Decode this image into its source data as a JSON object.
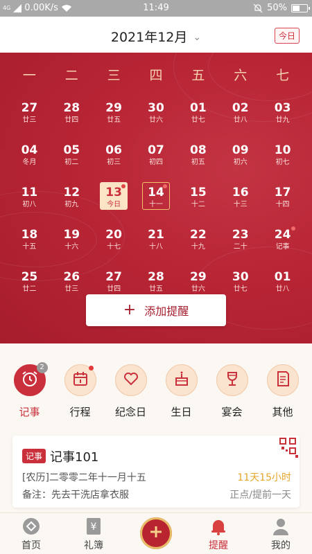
{
  "status_bar": {
    "network": "4G",
    "speed": "0.00K/s",
    "time": "11:49",
    "battery": "50%",
    "battery_level": 0.5
  },
  "header": {
    "month_label": "2021年12月",
    "today_label": "今日"
  },
  "calendar": {
    "weekdays": [
      "一",
      "二",
      "三",
      "四",
      "五",
      "六",
      "七"
    ],
    "days": [
      {
        "num": "27",
        "lunar": "廿三"
      },
      {
        "num": "28",
        "lunar": "廿四"
      },
      {
        "num": "29",
        "lunar": "廿五"
      },
      {
        "num": "30",
        "lunar": "廿六"
      },
      {
        "num": "01",
        "lunar": "廿七"
      },
      {
        "num": "02",
        "lunar": "廿八"
      },
      {
        "num": "03",
        "lunar": "廿九"
      },
      {
        "num": "04",
        "lunar": "冬月"
      },
      {
        "num": "05",
        "lunar": "初二"
      },
      {
        "num": "06",
        "lunar": "初三"
      },
      {
        "num": "07",
        "lunar": "初四"
      },
      {
        "num": "08",
        "lunar": "初五"
      },
      {
        "num": "09",
        "lunar": "初六"
      },
      {
        "num": "10",
        "lunar": "初七"
      },
      {
        "num": "11",
        "lunar": "初八"
      },
      {
        "num": "12",
        "lunar": "初九"
      },
      {
        "num": "13",
        "lunar": "今日",
        "state": "today",
        "dot": true
      },
      {
        "num": "14",
        "lunar": "十一",
        "state": "selected",
        "dot": true
      },
      {
        "num": "15",
        "lunar": "十二"
      },
      {
        "num": "16",
        "lunar": "十三"
      },
      {
        "num": "17",
        "lunar": "十四"
      },
      {
        "num": "18",
        "lunar": "十五"
      },
      {
        "num": "19",
        "lunar": "十六"
      },
      {
        "num": "20",
        "lunar": "十七"
      },
      {
        "num": "21",
        "lunar": "十八"
      },
      {
        "num": "22",
        "lunar": "十九"
      },
      {
        "num": "23",
        "lunar": "二十"
      },
      {
        "num": "24",
        "lunar": "记事",
        "dot": true
      },
      {
        "num": "25",
        "lunar": "廿二"
      },
      {
        "num": "26",
        "lunar": "廿三"
      },
      {
        "num": "27",
        "lunar": "廿四"
      },
      {
        "num": "28",
        "lunar": "廿五"
      },
      {
        "num": "29",
        "lunar": "廿六"
      },
      {
        "num": "30",
        "lunar": "廿七"
      },
      {
        "num": "01",
        "lunar": "廿八"
      }
    ],
    "add_button_label": "添加提醒"
  },
  "categories": [
    {
      "label": "记事",
      "icon": "alarm-clock-icon",
      "active": true,
      "badge": "2"
    },
    {
      "label": "行程",
      "icon": "calendar-icon",
      "reddot": true
    },
    {
      "label": "纪念日",
      "icon": "heart-icon"
    },
    {
      "label": "生日",
      "icon": "cake-icon"
    },
    {
      "label": "宴会",
      "icon": "wine-glass-icon"
    },
    {
      "label": "其他",
      "icon": "document-icon"
    }
  ],
  "reminder_card": {
    "tag": "记事",
    "title": "记事101",
    "lunar_date": "[农历]二零零二年十一月十五",
    "countdown": "11天15小时",
    "note": "备注：先去干洗店拿衣服",
    "remind": "正点/提前一天"
  },
  "tabbar": [
    {
      "label": "首页",
      "icon": "home-icon"
    },
    {
      "label": "礼簿",
      "icon": "ledger-icon"
    },
    {
      "label": "",
      "icon": "add-icon"
    },
    {
      "label": "提醒",
      "icon": "bell-icon",
      "active": true
    },
    {
      "label": "我的",
      "icon": "user-icon"
    }
  ],
  "colors": {
    "primary": "#c9303c",
    "calendar_bg": "#b82535",
    "accent_gold": "#f4c16f",
    "countdown": "#e6a52a"
  }
}
